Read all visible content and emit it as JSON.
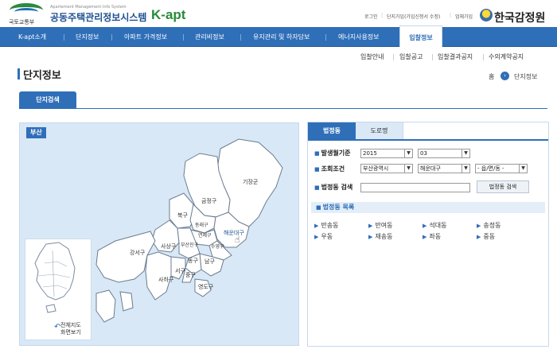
{
  "header": {
    "ministry": "국토교통부",
    "subtitle": "Apartement Management Info System",
    "title": "공동주택관리정보시스템",
    "brand": "K-apt",
    "util_links": [
      "로그인",
      "단지가입(가입신청서 수정)",
      "업체가입"
    ],
    "org_name": "한국감정원"
  },
  "nav": {
    "items": [
      "K-apt소개",
      "단지정보",
      "아파트 가격정보",
      "관리비정보",
      "유지관리 및 하자담보",
      "에너지사용정보",
      "입찰정보"
    ],
    "active": "입찰정보"
  },
  "subnav": [
    "입찰안내",
    "입찰공고",
    "입찰결과공지",
    "수의계약공지"
  ],
  "page": {
    "title": "단지정보",
    "breadcrumb_home": "홈",
    "breadcrumb_current": "단지정보",
    "main_tab": "단지검색"
  },
  "map": {
    "region": "부산",
    "districts": [
      "기장군",
      "금정구",
      "북구",
      "동래구",
      "연제구",
      "해운대구",
      "강서구",
      "사상구",
      "부산진구",
      "수영구",
      "남구",
      "동구",
      "서구",
      "중구",
      "사하구",
      "영도구"
    ],
    "korea_back": [
      "전체지도",
      "화면보기"
    ]
  },
  "search": {
    "tabs": [
      "법정동",
      "도로명"
    ],
    "active_tab": "법정동",
    "period_label": "발생월기준",
    "year": "2015",
    "month": "03",
    "cond_label": "조회조건",
    "sido": "부산광역시",
    "sigungu": "해운대구",
    "eupmyeon": "- 읍/면/동 -",
    "dong_label": "법정동 검색",
    "dong_input": "",
    "search_button": "법정동 검색",
    "list_title": "법정동 목록",
    "dongs": [
      "반송동",
      "반여동",
      "석대동",
      "송정동",
      "우동",
      "재송동",
      "좌동",
      "중동"
    ]
  }
}
